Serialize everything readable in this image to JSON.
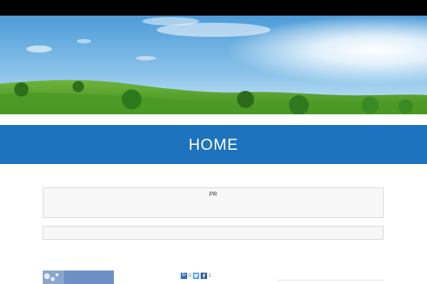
{
  "page": {
    "title": "HOME",
    "title_band_color": "#1e73be",
    "top_bar_color": "#000000"
  },
  "hero": {
    "image": "landscape-green-hills-blue-sky-sun"
  },
  "ad": {
    "label": "PR"
  },
  "social": {
    "hatena_label": "B!",
    "hatena_count": "0",
    "twitter_icon": "twitter-icon",
    "facebook_icon": "facebook-icon",
    "facebook_count": "1",
    "colors": {
      "hatena": "#2c6ebd",
      "twitter": "#55acee",
      "facebook": "#3b5998"
    }
  },
  "post": {
    "thumbnail": "sky-blossom-thumbnail"
  }
}
